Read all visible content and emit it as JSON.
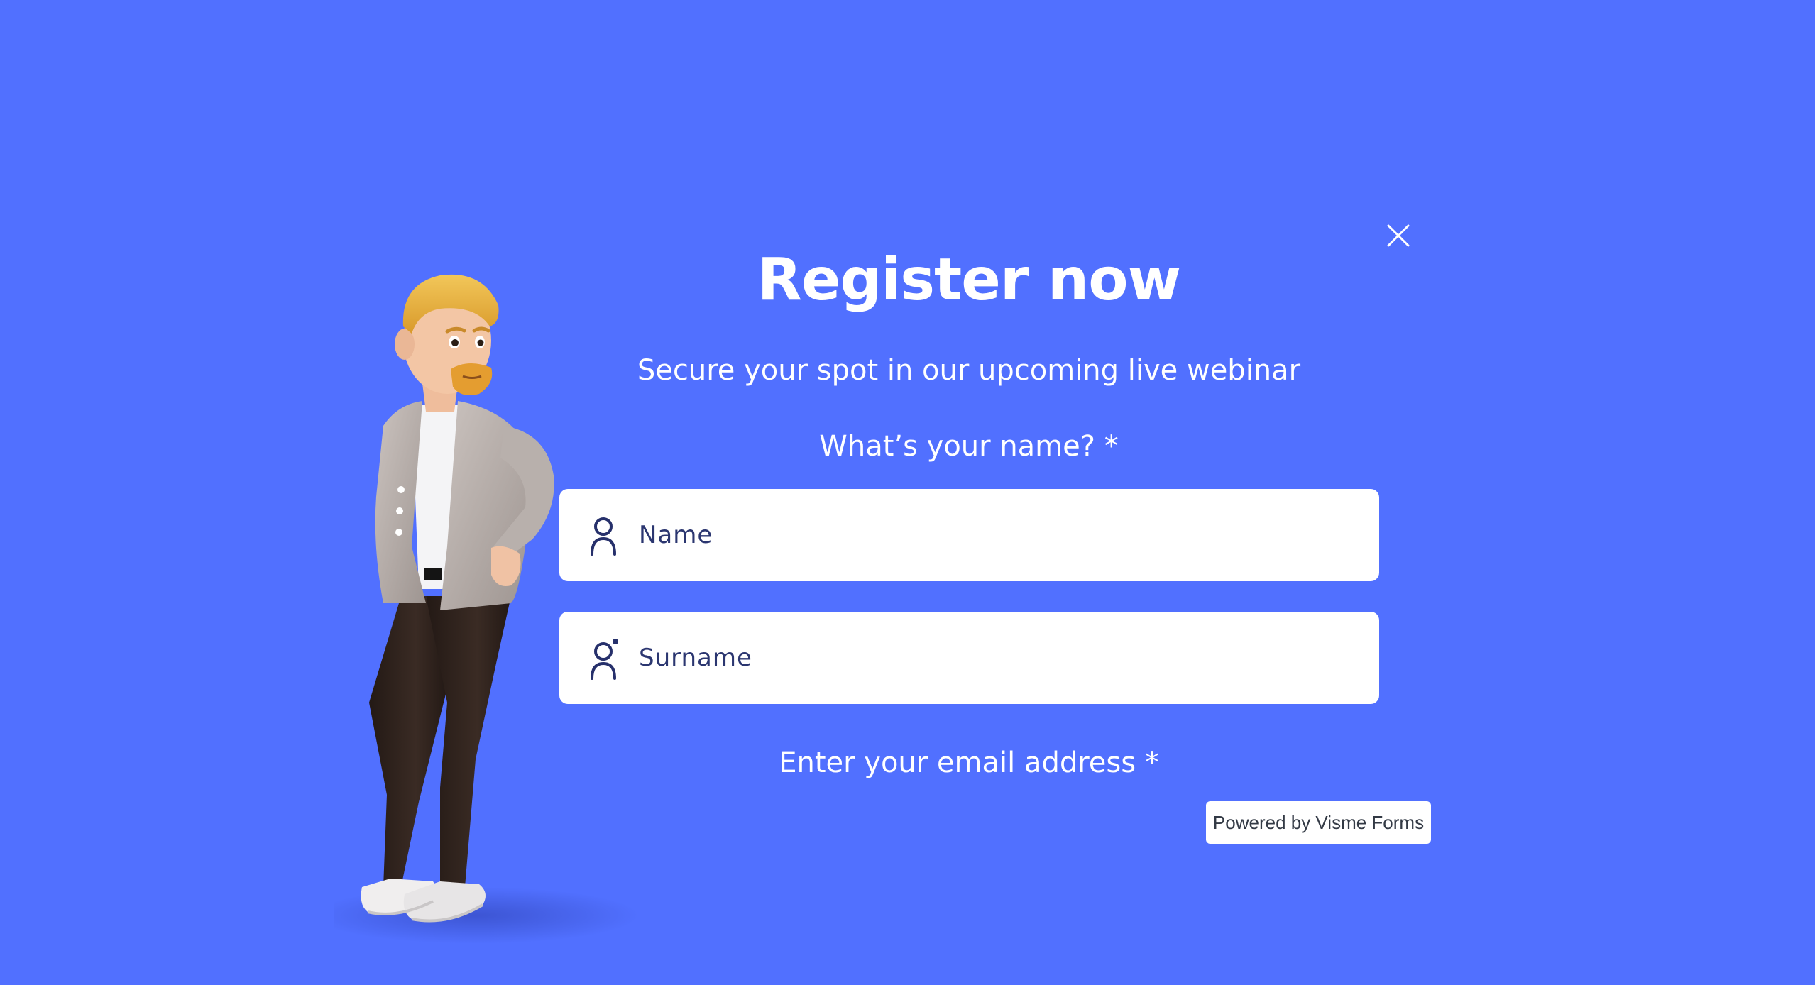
{
  "form": {
    "title": "Register now",
    "subtitle": "Secure your spot in our upcoming live webinar",
    "name_question": "What’s your name? *",
    "email_question": "Enter your email address *",
    "name_field": {
      "placeholder": "Name",
      "value": "",
      "icon": "person-icon"
    },
    "surname_field": {
      "placeholder": "Surname",
      "value": "",
      "icon": "person-dot-icon"
    },
    "close_icon": "close-icon"
  },
  "footer": {
    "powered_label": "Powered by Visme Forms"
  },
  "colors": {
    "background": "#5170ff",
    "field_background": "#ffffff",
    "text": "#ffffff",
    "field_text": "#2b3670"
  }
}
